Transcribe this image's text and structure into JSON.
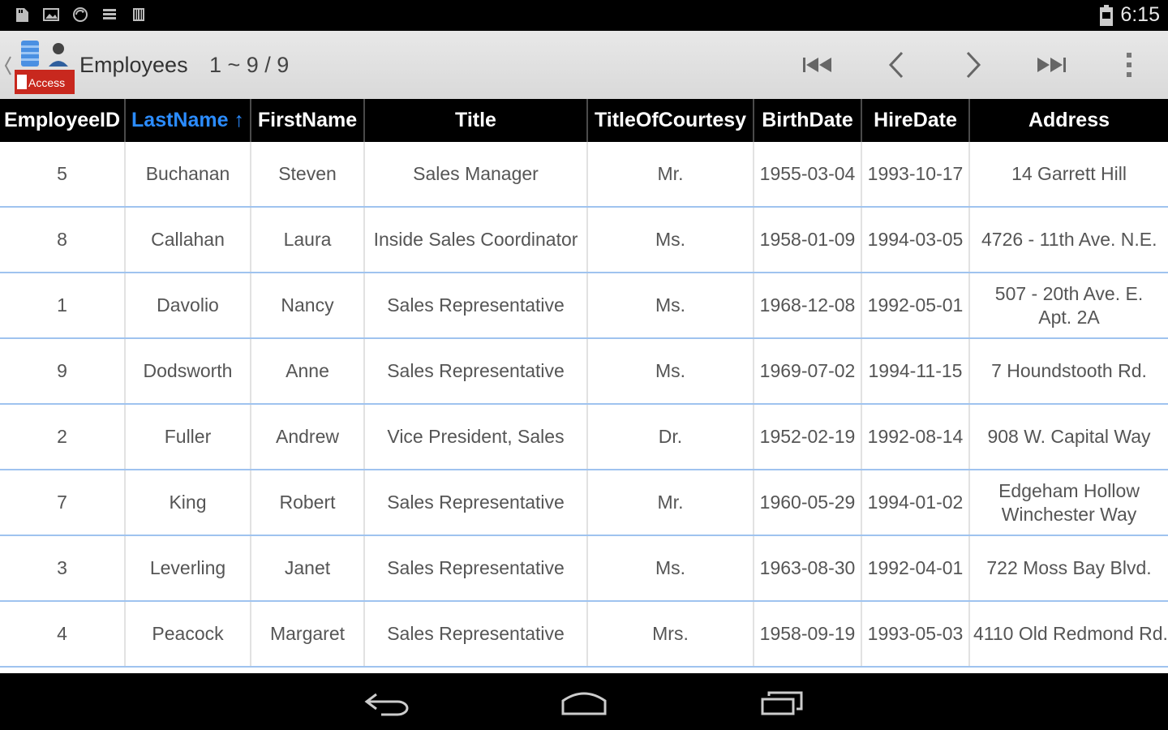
{
  "status_bar": {
    "time": "6:15",
    "icons": [
      "sd-card-icon",
      "image-icon",
      "sync-icon",
      "list-icon",
      "barcode-icon"
    ],
    "battery_icon": "battery-icon"
  },
  "action_bar": {
    "title": "Employees",
    "range": "1 ~ 9 / 9",
    "logo_label": "Access",
    "buttons": [
      "first-page",
      "previous-page",
      "next-page",
      "last-page",
      "overflow-menu"
    ]
  },
  "table": {
    "columns": [
      "EmployeeID",
      "LastName ↑",
      "FirstName",
      "Title",
      "TitleOfCourtesy",
      "BirthDate",
      "HireDate",
      "Address"
    ],
    "sorted_column": "LastName",
    "rows": [
      [
        "5",
        "Buchanan",
        "Steven",
        "Sales Manager",
        "Mr.",
        "1955-03-04",
        "1993-10-17",
        "14 Garrett Hill"
      ],
      [
        "8",
        "Callahan",
        "Laura",
        "Inside Sales Coordinator",
        "Ms.",
        "1958-01-09",
        "1994-03-05",
        "4726 - 11th Ave. N.E."
      ],
      [
        "1",
        "Davolio",
        "Nancy",
        "Sales Representative",
        "Ms.",
        "1968-12-08",
        "1992-05-01",
        "507 - 20th Ave. E. Apt. 2A"
      ],
      [
        "9",
        "Dodsworth",
        "Anne",
        "Sales Representative",
        "Ms.",
        "1969-07-02",
        "1994-11-15",
        "7 Houndstooth Rd."
      ],
      [
        "2",
        "Fuller",
        "Andrew",
        "Vice President, Sales",
        "Dr.",
        "1952-02-19",
        "1992-08-14",
        "908 W. Capital Way"
      ],
      [
        "7",
        "King",
        "Robert",
        "Sales Representative",
        "Mr.",
        "1960-05-29",
        "1994-01-02",
        "Edgeham Hollow Winchester Way"
      ],
      [
        "3",
        "Leverling",
        "Janet",
        "Sales Representative",
        "Ms.",
        "1963-08-30",
        "1992-04-01",
        "722 Moss Bay Blvd."
      ],
      [
        "4",
        "Peacock",
        "Margaret",
        "Sales Representative",
        "Mrs.",
        "1958-09-19",
        "1993-05-03",
        "4110 Old Redmond Rd."
      ]
    ]
  },
  "colors": {
    "accent": "#2b8cff",
    "row_divider": "#9fc3ef",
    "header_bg": "#000000",
    "action_bar_bg": "#e0e0e0"
  }
}
